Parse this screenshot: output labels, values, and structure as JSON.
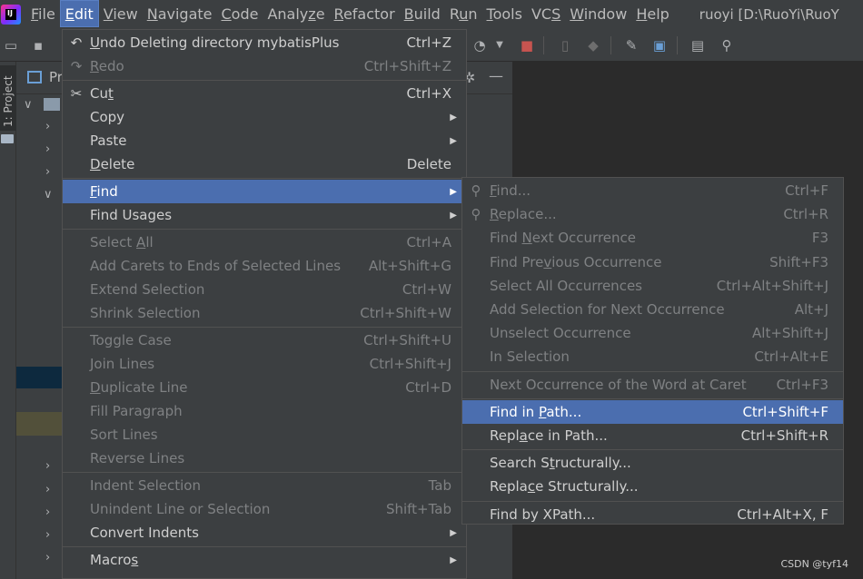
{
  "menubar": {
    "items": [
      {
        "label": "File",
        "mn": "F"
      },
      {
        "label": "Edit",
        "mn": "E"
      },
      {
        "label": "View",
        "mn": "V"
      },
      {
        "label": "Navigate",
        "mn": "N"
      },
      {
        "label": "Code",
        "mn": "C"
      },
      {
        "label": "Analyze",
        "mn": "z"
      },
      {
        "label": "Refactor",
        "mn": "R"
      },
      {
        "label": "Build",
        "mn": "B"
      },
      {
        "label": "Run",
        "mn": "u"
      },
      {
        "label": "Tools",
        "mn": "T"
      },
      {
        "label": "VCS",
        "mn": "S"
      },
      {
        "label": "Window",
        "mn": "W"
      },
      {
        "label": "Help",
        "mn": "H"
      }
    ],
    "project_title": "ruoyi [D:\\RuoYi\\RuoY"
  },
  "left_strip": {
    "project_tab": "1: Project"
  },
  "project_panel": {
    "title": "Pr"
  },
  "watermark": "CSDN @tyf14",
  "edit_menu": {
    "items": [
      {
        "icon": "undo-icon",
        "glyph": "↶",
        "label": "Undo Deleting directory mybatisPlus",
        "mn": "U",
        "shortcut": "Ctrl+Z",
        "enabled": true
      },
      {
        "icon": "redo-icon",
        "glyph": "↷",
        "label": "Redo",
        "mn": "R",
        "shortcut": "Ctrl+Shift+Z",
        "enabled": false
      },
      {
        "sep": true
      },
      {
        "icon": "cut-icon",
        "glyph": "✂",
        "label": "Cut",
        "mn": "t",
        "shortcut": "Ctrl+X",
        "enabled": true
      },
      {
        "label": "Copy",
        "mn": "",
        "submenu": true,
        "enabled": true
      },
      {
        "label": "Paste",
        "mn": "",
        "submenu": true,
        "enabled": true
      },
      {
        "label": "Delete",
        "mn": "D",
        "shortcut": "Delete",
        "enabled": true
      },
      {
        "sep": true
      },
      {
        "label": "Find",
        "mn": "F",
        "submenu": true,
        "enabled": true,
        "selected": true
      },
      {
        "label": "Find Usages",
        "mn": "",
        "submenu": true,
        "enabled": true
      },
      {
        "sep": true
      },
      {
        "label": "Select All",
        "mn": "A",
        "shortcut": "Ctrl+A",
        "enabled": false
      },
      {
        "label": "Add Carets to Ends of Selected Lines",
        "mn": "",
        "shortcut": "Alt+Shift+G",
        "enabled": false
      },
      {
        "label": "Extend Selection",
        "mn": "",
        "shortcut": "Ctrl+W",
        "enabled": false
      },
      {
        "label": "Shrink Selection",
        "mn": "",
        "shortcut": "Ctrl+Shift+W",
        "enabled": false
      },
      {
        "sep": true
      },
      {
        "label": "Toggle Case",
        "mn": "",
        "shortcut": "Ctrl+Shift+U",
        "enabled": false
      },
      {
        "label": "Join Lines",
        "mn": "",
        "shortcut": "Ctrl+Shift+J",
        "enabled": false
      },
      {
        "label": "Duplicate Line",
        "mn": "D",
        "shortcut": "Ctrl+D",
        "enabled": false
      },
      {
        "label": "Fill Paragraph",
        "mn": "",
        "enabled": false
      },
      {
        "label": "Sort Lines",
        "mn": "",
        "enabled": false
      },
      {
        "label": "Reverse Lines",
        "mn": "",
        "enabled": false
      },
      {
        "sep": true
      },
      {
        "label": "Indent Selection",
        "mn": "",
        "shortcut": "Tab",
        "enabled": false
      },
      {
        "label": "Unindent Line or Selection",
        "mn": "",
        "shortcut": "Shift+Tab",
        "enabled": false
      },
      {
        "label": "Convert Indents",
        "mn": "",
        "submenu": true,
        "enabled": true
      },
      {
        "sep": true
      },
      {
        "label": "Macros",
        "mn": "s",
        "submenu": true,
        "enabled": true
      }
    ]
  },
  "find_menu": {
    "items": [
      {
        "icon": "search-icon",
        "glyph": "⚲",
        "label": "Find...",
        "mn": "F",
        "shortcut": "Ctrl+F",
        "enabled": false
      },
      {
        "icon": "replace-icon",
        "glyph": "⚲",
        "label": "Replace...",
        "mn": "R",
        "shortcut": "Ctrl+R",
        "enabled": false
      },
      {
        "label": "Find Next Occurrence",
        "mn": "N",
        "shortcut": "F3",
        "enabled": false
      },
      {
        "label": "Find Previous Occurrence",
        "mn": "v",
        "shortcut": "Shift+F3",
        "enabled": false
      },
      {
        "label": "Select All Occurrences",
        "mn": "",
        "shortcut": "Ctrl+Alt+Shift+J",
        "enabled": false
      },
      {
        "label": "Add Selection for Next Occurrence",
        "mn": "",
        "shortcut": "Alt+J",
        "enabled": false
      },
      {
        "label": "Unselect Occurrence",
        "mn": "",
        "shortcut": "Alt+Shift+J",
        "enabled": false
      },
      {
        "label": "In Selection",
        "mn": "",
        "shortcut": "Ctrl+Alt+E",
        "enabled": false
      },
      {
        "sep": true
      },
      {
        "label": "Next Occurrence of the Word at Caret",
        "mn": "",
        "shortcut": "Ctrl+F3",
        "enabled": false
      },
      {
        "sep": true
      },
      {
        "label": "Find in Path...",
        "mn": "P",
        "shortcut": "Ctrl+Shift+F",
        "enabled": true,
        "selected": true
      },
      {
        "label": "Replace in Path...",
        "mn": "a",
        "shortcut": "Ctrl+Shift+R",
        "enabled": true
      },
      {
        "sep": true
      },
      {
        "label": "Search Structurally...",
        "mn": "t",
        "enabled": true
      },
      {
        "label": "Replace Structurally...",
        "mn": "c",
        "enabled": true
      },
      {
        "sep": true
      },
      {
        "label": "Find by XPath...",
        "mn": "",
        "shortcut": "Ctrl+Alt+X, F",
        "enabled": true
      }
    ]
  }
}
